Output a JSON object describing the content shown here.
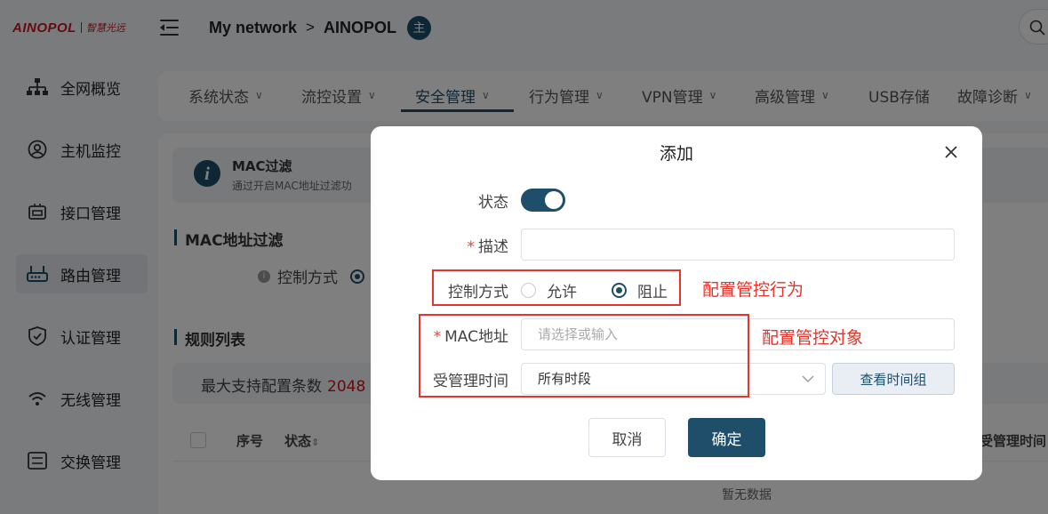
{
  "brand": {
    "name": "AINOPOL",
    "tagline": "智慧光远"
  },
  "header": {
    "breadcrumb": [
      "My network",
      "AINOPOL"
    ],
    "breadcrumb_sep": ">",
    "badge": "主"
  },
  "sidebar": {
    "items": [
      {
        "label": "全网概览",
        "icon": "topology-icon"
      },
      {
        "label": "主机监控",
        "icon": "user-circle-icon"
      },
      {
        "label": "接口管理",
        "icon": "interface-icon"
      },
      {
        "label": "路由管理",
        "icon": "router-icon",
        "active": true
      },
      {
        "label": "认证管理",
        "icon": "shield-check-icon"
      },
      {
        "label": "无线管理",
        "icon": "wifi-icon"
      },
      {
        "label": "交换管理",
        "icon": "switch-icon"
      }
    ]
  },
  "tabs": [
    {
      "label": "系统状态",
      "chevron": "∨"
    },
    {
      "label": "流控设置",
      "chevron": "∨"
    },
    {
      "label": "安全管理",
      "chevron": "∨",
      "active": true
    },
    {
      "label": "行为管理",
      "chevron": "∨"
    },
    {
      "label": "VPN管理",
      "chevron": "∨"
    },
    {
      "label": "高级管理",
      "chevron": "∨"
    },
    {
      "label": "USB存储",
      "chevron": ""
    },
    {
      "label": "故障诊断",
      "chevron": "∨"
    }
  ],
  "page": {
    "info_title": "MAC过滤",
    "info_desc": "通过开启MAC地址过滤功",
    "section1_title": "MAC地址过滤",
    "control_label": "控制方式",
    "section2_title": "规则列表",
    "max_label": "最大支持配置条数",
    "max_count": "2048",
    "table_headers": {
      "index": "序号",
      "status": "状态",
      "time": "受管理时间"
    },
    "empty_text": "暂无数据"
  },
  "dialog": {
    "title": "添加",
    "status_label": "状态",
    "status_on": true,
    "desc_label": "描述",
    "desc_value": "",
    "mode_label": "控制方式",
    "mode_options": [
      "允许",
      "阻止"
    ],
    "mode_selected": "阻止",
    "mac_label": "MAC地址",
    "mac_placeholder": "请选择或输入",
    "time_label": "受管理时间",
    "time_value": "所有时段",
    "view_time_group": "查看时间组",
    "cancel": "取消",
    "confirm": "确定"
  },
  "annotations": {
    "behavior": "配置管控行为",
    "target": "配置管控对象"
  },
  "colors": {
    "primary": "#1f4e6b",
    "brand_red": "#c8161e",
    "annotation_red": "#e8332a"
  }
}
